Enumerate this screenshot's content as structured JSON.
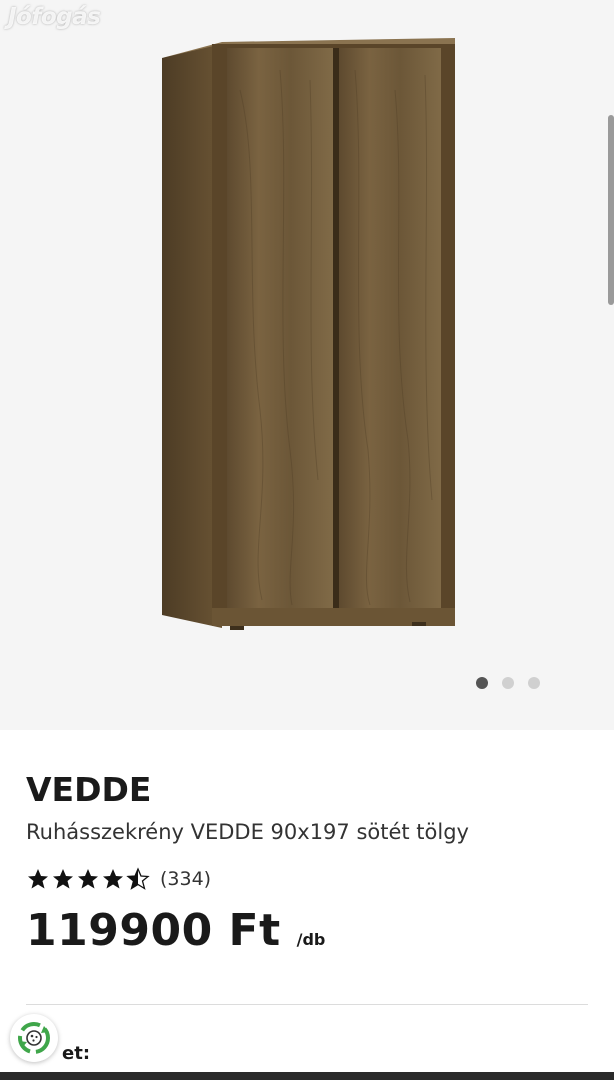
{
  "watermark": {
    "text": "Jófogás"
  },
  "gallery": {
    "image_icon": "wardrobe-image",
    "slide_count": 3,
    "active_slide": 1
  },
  "product": {
    "brand": "VEDDE",
    "name": "Ruhásszekrény VEDDE 90x197 sötét tölgy",
    "rating": 4.5,
    "reviews": "(334)",
    "price": "119900 Ft",
    "unit": "/db"
  },
  "section": {
    "label_partial": "et:"
  },
  "colors": {
    "wood": "#6b5535",
    "star": "#111111",
    "fab_ring": "#3fa64a"
  }
}
